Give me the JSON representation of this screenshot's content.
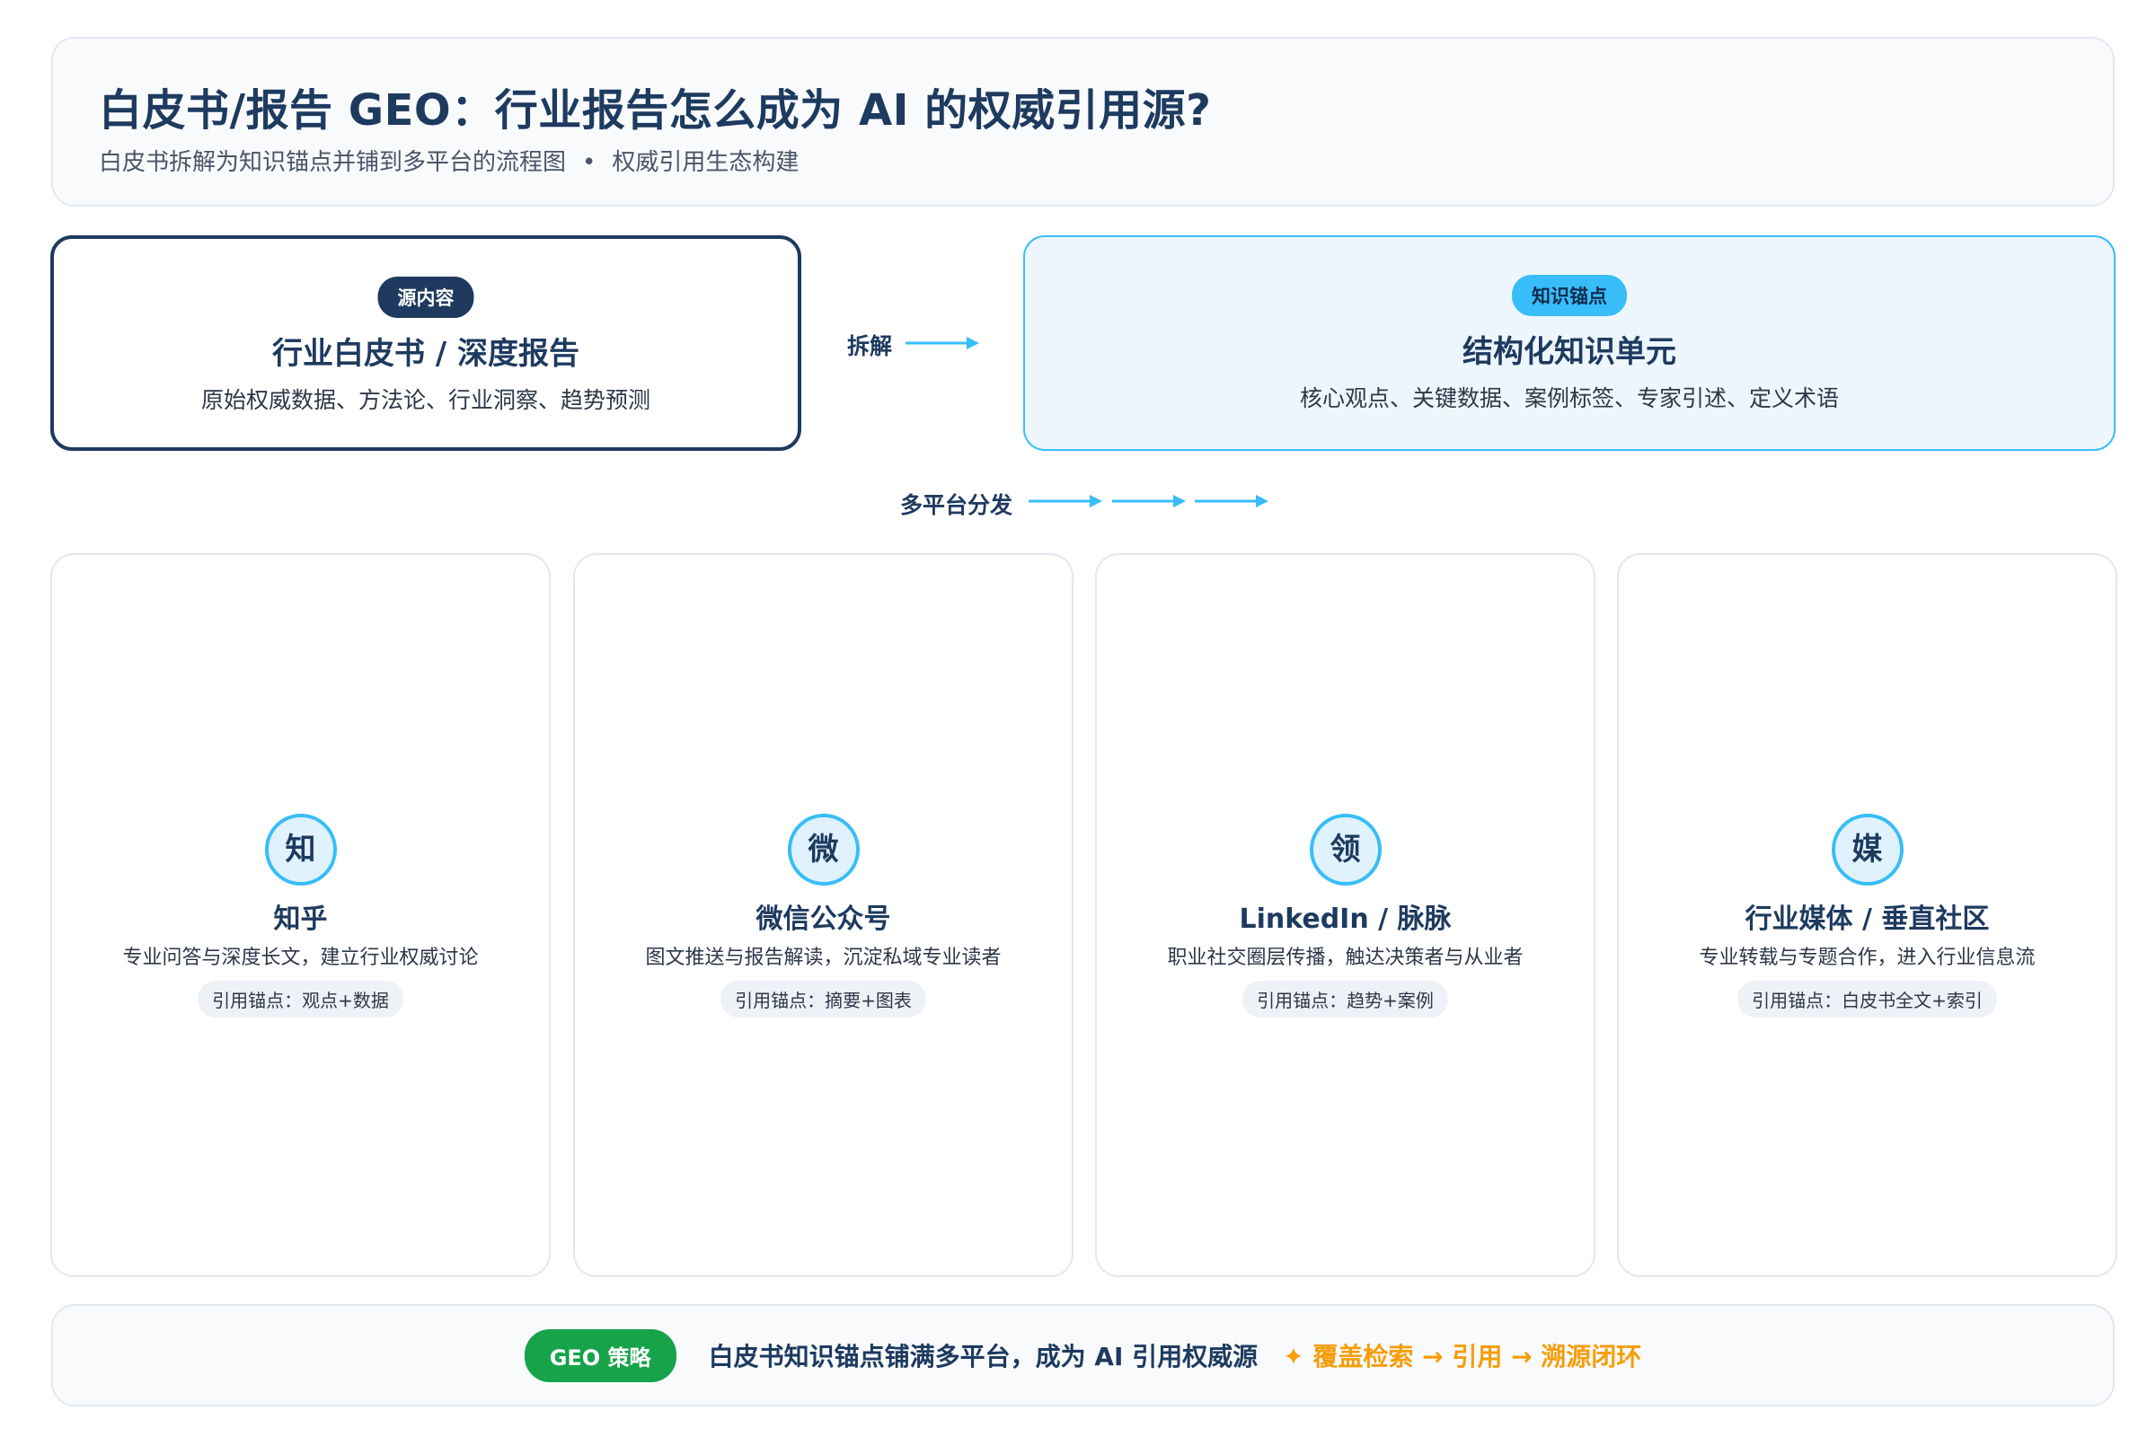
{
  "header": {
    "title": "白皮书/报告 GEO：行业报告怎么成为 AI 的权威引用源?",
    "subtitle": "白皮书拆解为知识锚点并铺到多平台的流程图",
    "subtitle_separator": "•",
    "subtitle_suffix": "权威引用生态构建"
  },
  "source": {
    "badge": "源内容",
    "title": "行业白皮书 / 深度报告",
    "desc": "原始权威数据、方法论、行业洞察、趋势预测"
  },
  "flow": {
    "decompose_label": "拆解",
    "distribute_label": "多平台分发"
  },
  "anchor": {
    "badge": "知识锚点",
    "title": "结构化知识单元",
    "desc": "核心观点、关键数据、案例标签、专家引述、定义术语"
  },
  "platforms": [
    {
      "icon_char": "知",
      "name": "知乎",
      "desc": "专业问答与深度长文，建立行业权威讨论",
      "tag": "引用锚点：观点+数据"
    },
    {
      "icon_char": "微",
      "name": "微信公众号",
      "desc": "图文推送与报告解读，沉淀私域专业读者",
      "tag": "引用锚点：摘要+图表"
    },
    {
      "icon_char": "领",
      "name": "LinkedIn / 脉脉",
      "desc": "职业社交圈层传播，触达决策者与从业者",
      "tag": "引用锚点：趋势+案例"
    },
    {
      "icon_char": "媒",
      "name": "行业媒体 / 垂直社区",
      "desc": "专业转载与专题合作，进入行业信息流",
      "tag": "引用锚点：白皮书全文+索引"
    }
  ],
  "footer": {
    "badge": "GEO 策略",
    "text": "白皮书知识锚点铺满多平台，成为 AI 引用权威源",
    "accent": "✦ 覆盖检索 → 引用 → 溯源闭环"
  },
  "colors": {
    "navy": "#1e3a5f",
    "sky": "#38bdf8",
    "green": "#16a34a",
    "amber": "#f59e0b"
  }
}
